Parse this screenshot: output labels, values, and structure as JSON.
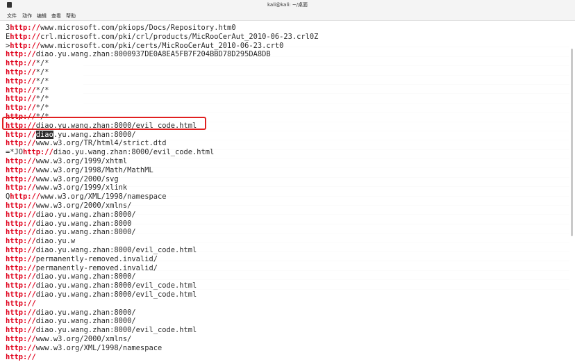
{
  "window": {
    "title": "kali@kali: ~/桌面"
  },
  "menu": [
    "文件",
    "动作",
    "编辑",
    "查看",
    "帮助"
  ],
  "lines": [
    {
      "prefix": "3",
      "scheme": "http://",
      "rest": "www.microsoft.com/pkiops/Docs/Repository.htm0"
    },
    {
      "prefix": "E",
      "scheme": "http://",
      "rest": "crl.microsoft.com/pki/crl/products/MicRooCerAut_2010-06-23.crl0Z"
    },
    {
      "prefix": ">",
      "scheme": "http://",
      "rest": "www.microsoft.com/pki/certs/MicRooCerAut_2010-06-23.crt0"
    },
    {
      "prefix": "",
      "scheme": "http://",
      "rest": "diao.yu.wang.zhan:8000937DE0A8EA5FB7F204BBD78D295DA8DB"
    },
    {
      "prefix": "",
      "scheme": "http://",
      "rest": "*/*"
    },
    {
      "prefix": "",
      "scheme": "http://",
      "rest": "*/*"
    },
    {
      "prefix": "",
      "scheme": "http://",
      "rest": "*/*"
    },
    {
      "prefix": "",
      "scheme": "http://",
      "rest": "*/*"
    },
    {
      "prefix": "",
      "scheme": "http://",
      "rest": "*/*"
    },
    {
      "prefix": "",
      "scheme": "http://",
      "rest": "*/*"
    },
    {
      "prefix": "",
      "scheme": "http://",
      "rest": "*/*"
    },
    {
      "prefix": "",
      "scheme": "http://",
      "rest": "diao.yu.wang.zhan:8000/evil_code.html"
    },
    {
      "prefix": "",
      "scheme": "http://",
      "sel": "diao",
      "rest": ".yu.wang.zhan:8000/"
    },
    {
      "prefix": "",
      "scheme": "http://",
      "rest": "www.w3.org/TR/html4/strict.dtd"
    },
    {
      "prefix": "=*JO",
      "scheme": "http://",
      "rest": "diao.yu.wang.zhan:8000/evil_code.html"
    },
    {
      "prefix": "",
      "scheme": "http://",
      "rest": "www.w3.org/1999/xhtml"
    },
    {
      "prefix": "",
      "scheme": "http://",
      "rest": "www.w3.org/1998/Math/MathML"
    },
    {
      "prefix": "",
      "scheme": "http://",
      "rest": "www.w3.org/2000/svg"
    },
    {
      "prefix": "",
      "scheme": "http://",
      "rest": "www.w3.org/1999/xlink"
    },
    {
      "prefix": "Q",
      "scheme": "http://",
      "rest": "www.w3.org/XML/1998/namespace"
    },
    {
      "prefix": "",
      "scheme": "http://",
      "rest": "www.w3.org/2000/xmlns/"
    },
    {
      "prefix": "",
      "scheme": "http://",
      "rest": "diao.yu.wang.zhan:8000/"
    },
    {
      "prefix": "",
      "scheme": "http://",
      "rest": "diao.yu.wang.zhan:8000"
    },
    {
      "prefix": "",
      "scheme": "http://",
      "rest": "diao.yu.wang.zhan:8000/"
    },
    {
      "prefix": "",
      "scheme": "http://",
      "rest": "diao.yu.w"
    },
    {
      "prefix": "",
      "scheme": "http://",
      "rest": "diao.yu.wang.zhan:8000/evil_code.html"
    },
    {
      "prefix": "",
      "scheme": "http://",
      "rest": "permanently-removed.invalid/"
    },
    {
      "prefix": "",
      "scheme": "http://",
      "rest": "permanently-removed.invalid/"
    },
    {
      "prefix": "",
      "scheme": "http://",
      "rest": "diao.yu.wang.zhan:8000/"
    },
    {
      "prefix": "",
      "scheme": "http://",
      "rest": "diao.yu.wang.zhan:8000/evil_code.html"
    },
    {
      "prefix": "",
      "scheme": "http://",
      "rest": "diao.yu.wang.zhan:8000/evil_code.html"
    },
    {
      "prefix": "",
      "scheme": "http://",
      "rest": ""
    },
    {
      "prefix": "",
      "scheme": "http://",
      "rest": "diao.yu.wang.zhan:8000/"
    },
    {
      "prefix": "",
      "scheme": "http://",
      "rest": "diao.yu.wang.zhan:8000/"
    },
    {
      "prefix": "",
      "scheme": "http://",
      "rest": "diao.yu.wang.zhan:8000/evil_code.html"
    },
    {
      "prefix": "",
      "scheme": "http://",
      "rest": "www.w3.org/2000/xmlns/"
    },
    {
      "prefix": "",
      "scheme": "http://",
      "rest": "www.w3.org/XML/1998/namespace"
    },
    {
      "prefix": "",
      "scheme": "http://",
      "rest": ""
    }
  ],
  "annotation": {
    "highlighted_line": 11,
    "color": "#e02020"
  },
  "colors": {
    "scheme": "#e0001b",
    "text": "#2b2b2b",
    "background": "#ffffff"
  }
}
